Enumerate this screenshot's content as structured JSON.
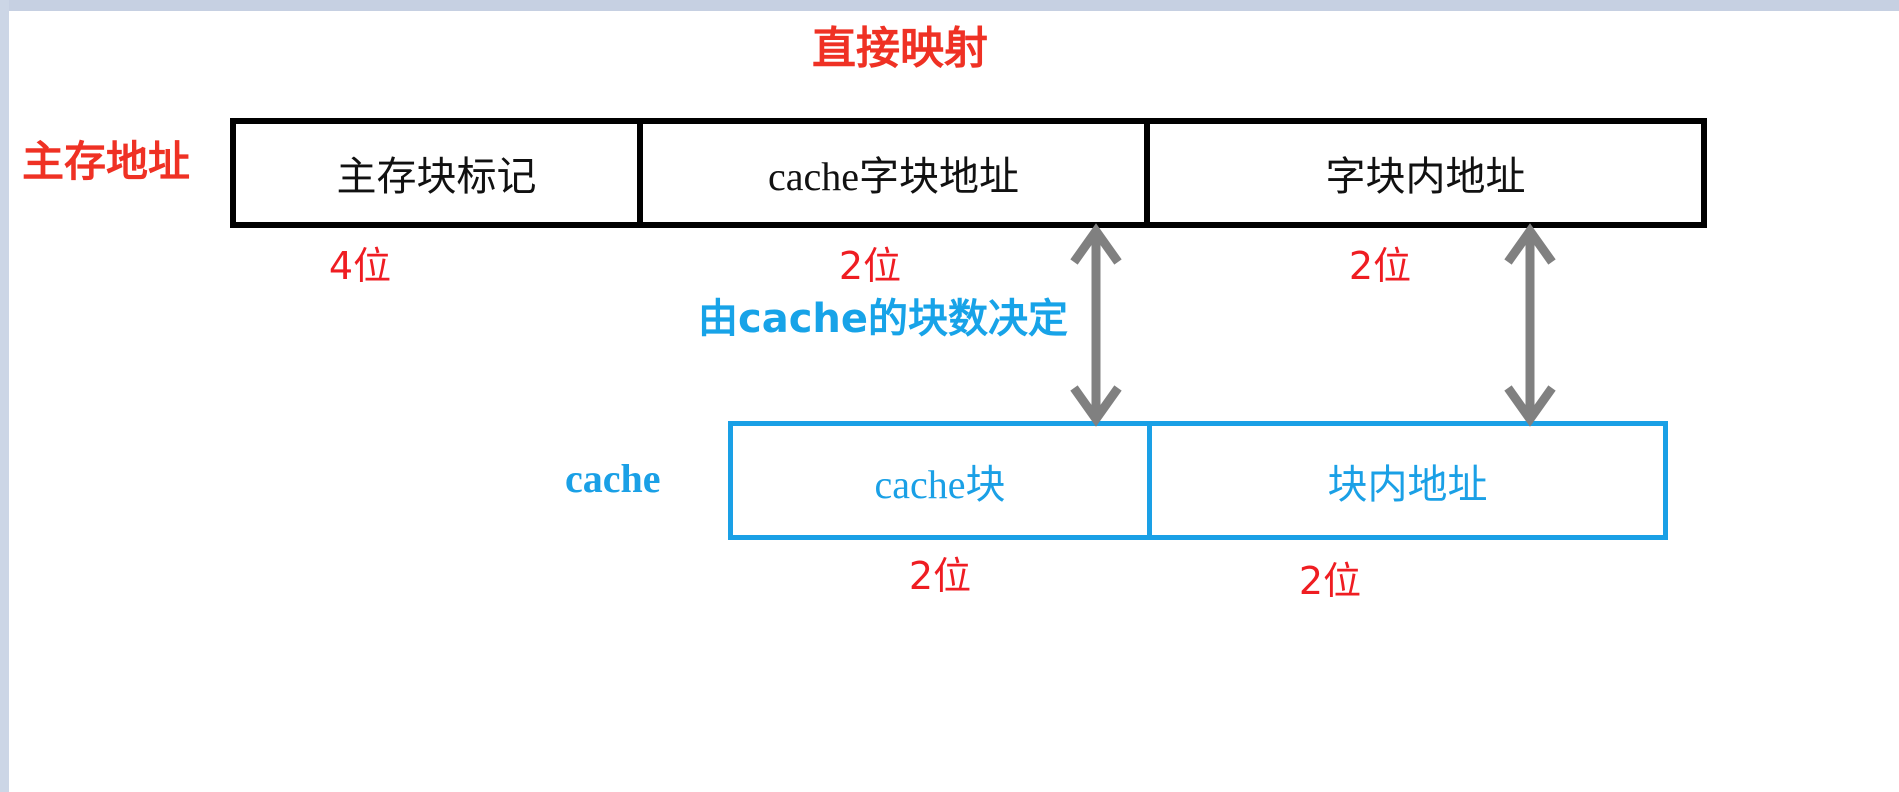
{
  "diagram": {
    "title": "直接映射",
    "main_address": {
      "label": "主存地址",
      "fields": [
        {
          "name": "主存块标记",
          "bits": "4位"
        },
        {
          "name": "cache字块地址",
          "bits": "2位"
        },
        {
          "name": "字块内地址",
          "bits": "2位"
        }
      ]
    },
    "cache": {
      "label": "cache",
      "fields": [
        {
          "name": "cache块",
          "bits": "2位"
        },
        {
          "name": "块内地址",
          "bits": "2位"
        }
      ]
    },
    "annotation": "由cache的块数决定",
    "colors": {
      "title_red": "#ef3124",
      "bits_red": "#ef1d22",
      "cache_blue": "#1aa0e6",
      "note_blue": "#17a3e8",
      "box_black": "#000000",
      "arrow_gray": "#808080",
      "page_edge": "#c6d0e2"
    },
    "icons": {
      "left_arrow": "double-arrow-vertical-icon",
      "right_arrow": "double-arrow-vertical-icon"
    }
  }
}
